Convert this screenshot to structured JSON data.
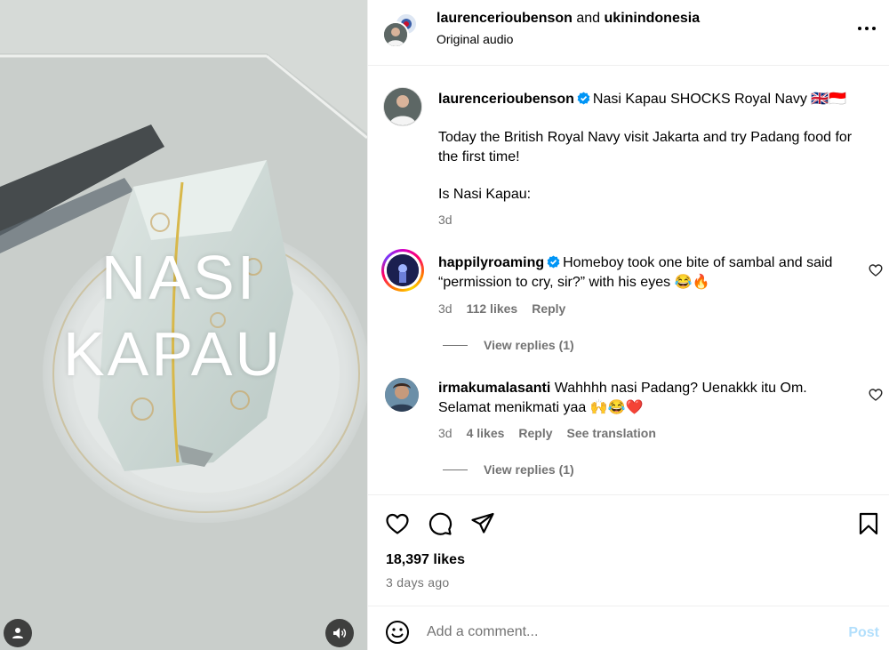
{
  "media": {
    "overlay_line1": "NASI",
    "overlay_line2": "KAPAU",
    "user_tag_icon": "user-icon",
    "mute_icon": "speaker-icon"
  },
  "header": {
    "author1": "laurencerioubenson",
    "joiner": " and ",
    "author2": "ukinindonesia",
    "audio": "Original audio",
    "more_icon": "more-icon"
  },
  "caption": {
    "username": "laurencerioubenson",
    "title": "Nasi Kapau SHOCKS Royal Navy 🇬🇧🇮🇩",
    "body": "Today the British Royal Navy visit Jakarta and try Padang food for the first time!",
    "body2": "Is Nasi Kapau:",
    "time": "3d"
  },
  "comments": [
    {
      "username": "happilyroaming",
      "verified": true,
      "text": "Homeboy took one bite of sambal and said “permission to cry, sir?” with his eyes 😂🔥",
      "time": "3d",
      "likes": "112 likes",
      "reply": "Reply",
      "view_replies": "View replies (1)"
    },
    {
      "username": "irmakumalasanti",
      "verified": false,
      "text": "Wahhhh nasi Padang? Uenakkk itu Om. Selamat menikmati yaa 🙌😂❤️",
      "time": "3d",
      "likes": "4 likes",
      "reply": "Reply",
      "translate": "See translation",
      "view_replies": "View replies (1)"
    }
  ],
  "actions": {
    "like_icon": "heart-icon",
    "comment_icon": "comment-icon",
    "share_icon": "send-icon",
    "save_icon": "bookmark-icon",
    "likes": "18,397 likes",
    "posted": "3 days ago"
  },
  "comment_box": {
    "emoji_icon": "emoji-icon",
    "placeholder": "Add a comment...",
    "value": "",
    "post_label": "Post"
  },
  "colors": {
    "verified": "#0095f6",
    "secondary_text": "#737373",
    "post_disabled": "#b2dffc",
    "divider": "#efefef"
  }
}
